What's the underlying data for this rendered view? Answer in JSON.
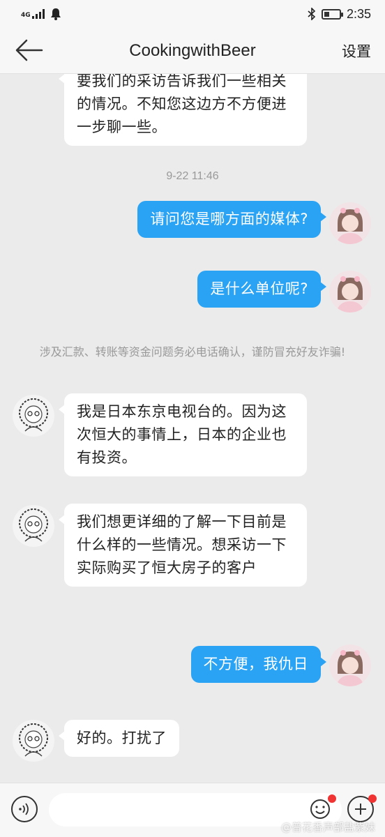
{
  "status_bar": {
    "network": "4G",
    "time": "2:35"
  },
  "header": {
    "title": "CookingwithBeer",
    "settings_label": "设置"
  },
  "messages": [
    {
      "side": "in",
      "text": "要我们的采访告诉我们一些相关的情况。不知您这边方不方便进一步聊一些。"
    },
    {
      "side": "out",
      "text": "请问您是哪方面的媒体?"
    },
    {
      "side": "out",
      "text": "是什么单位呢?"
    },
    {
      "side": "in",
      "text": "我是日本东京电视台的。因为这次恒大的事情上，日本的企业也有投资。"
    },
    {
      "side": "in",
      "text": "我们想更详细的了解一下目前是什么样的一些情况。想采访一下实际购买了恒大房子的客户"
    },
    {
      "side": "out",
      "text": "不方便，我仇日"
    },
    {
      "side": "in",
      "text": "好的。打扰了"
    }
  ],
  "timestamp": "9-22 11:46",
  "safety_notice": "涉及汇款、转账等资金问题务必电话确认，谨防冒充好友诈骗!",
  "input_bar": {
    "placeholder": ""
  },
  "watermark": "@普花香声部盐紫妹",
  "colors": {
    "outgoing_bubble": "#2aa3f5",
    "incoming_bubble": "#ffffff",
    "background": "#ebebeb",
    "notification_dot": "#f03434"
  }
}
